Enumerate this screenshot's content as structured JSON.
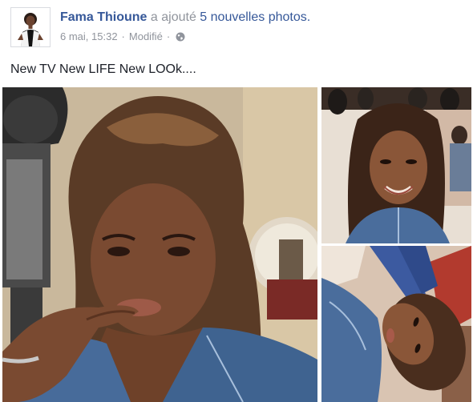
{
  "post": {
    "author": "Fama Thioune",
    "action": "a ajouté",
    "photos_link": "5 nouvelles photos.",
    "date": "6 mai, 15:32",
    "separator": "·",
    "edited": "Modifié",
    "audience_icon": "globe-icon",
    "status": "New TV New LIFE New LOOk...."
  },
  "colors": {
    "author_link": "#365899",
    "meta_gray": "#90949c",
    "text": "#1d2129"
  },
  "photos": [
    {
      "name": "photo-main",
      "subject": "woman-finger-on-lips-denim-jacket"
    },
    {
      "name": "photo-top-right",
      "subject": "woman-smiling-selfie-salon"
    },
    {
      "name": "photo-bottom-right",
      "subject": "woman-lying-selfie-tilted"
    }
  ]
}
